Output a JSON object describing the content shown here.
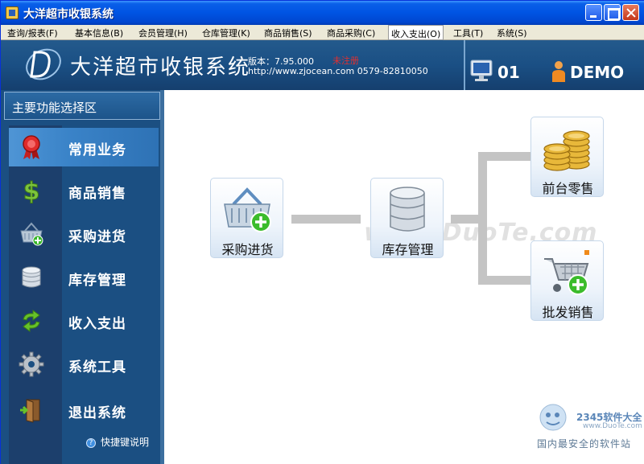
{
  "window": {
    "title": "大洋超市收银系统",
    "icon": "app-icon"
  },
  "menubar": {
    "items": [
      "查询/报表(F)",
      "基本信息(B)",
      "会员管理(H)",
      "仓库管理(K)",
      "商品销售(S)",
      "商品采购(C)",
      "收入支出(O)",
      "工具(T)",
      "系统(S)"
    ],
    "active": "收入支出(O)"
  },
  "header": {
    "brand_title": "大洋超市收银系统",
    "version": "版本：7.95.000",
    "unregistered": "未注册",
    "url_phone": "http://www.zjocean.com  0579-82810050",
    "terminal_no": "01",
    "user_name": "DEMO",
    "icons": [
      "logo-d-icon",
      "monitor-icon",
      "user-icon"
    ]
  },
  "sidebar": {
    "title": "主要功能选择区",
    "items": [
      {
        "label": "常用业务",
        "icon": "award-ribbon-icon",
        "active": true
      },
      {
        "label": "商品销售",
        "icon": "dollar-icon",
        "active": false
      },
      {
        "label": "采购进货",
        "icon": "basket-add-icon",
        "active": false
      },
      {
        "label": "库存管理",
        "icon": "database-icon",
        "active": false
      },
      {
        "label": "收入支出",
        "icon": "refresh-arrows-icon",
        "active": false
      },
      {
        "label": "系统工具",
        "icon": "gear-icon",
        "active": false
      },
      {
        "label": "退出系统",
        "icon": "exit-door-icon",
        "active": false
      }
    ],
    "help": "快捷键说明"
  },
  "workflow": {
    "nodes": [
      {
        "label": "采购进货",
        "icon": "basket-add-icon"
      },
      {
        "label": "库存管理",
        "icon": "database-icon"
      },
      {
        "label": "前台零售",
        "icon": "coins-icon"
      },
      {
        "label": "批发销售",
        "icon": "cart-add-icon"
      }
    ]
  },
  "overlays": {
    "watermark": "www.DuoTe.com",
    "corner_brand": "2345软件大全",
    "corner_url": "www.DuoTe.com",
    "corner_slogan": "国内最安全的软件站"
  },
  "colors": {
    "titlebar": "#0054e3",
    "header": "#1a4f84",
    "sidebar": "#1b4f82",
    "active_item": "#3a83c8",
    "unregistered": "#e23030",
    "flow_line": "#c4c4c4"
  }
}
